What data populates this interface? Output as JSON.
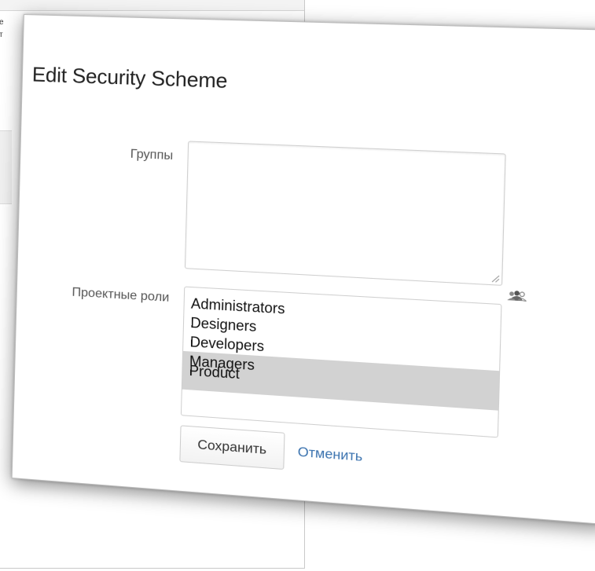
{
  "background": {
    "text_lines": [
      "e",
      "т"
    ]
  },
  "dialog": {
    "title": "Edit Security Scheme",
    "groups": {
      "label": "Группы",
      "value": ""
    },
    "group_picker_icon": "group-picker-icon",
    "roles": {
      "label": "Проектные роли",
      "options": [
        "Administrators",
        "Designers",
        "Developers",
        "Managers",
        "Product"
      ],
      "selected": [
        "Managers",
        "Product"
      ]
    },
    "buttons": {
      "save_label": "Сохранить",
      "cancel_label": "Отменить"
    }
  },
  "colors": {
    "link": "#3b73af",
    "selected_option_bg": "#d2d2d2"
  }
}
